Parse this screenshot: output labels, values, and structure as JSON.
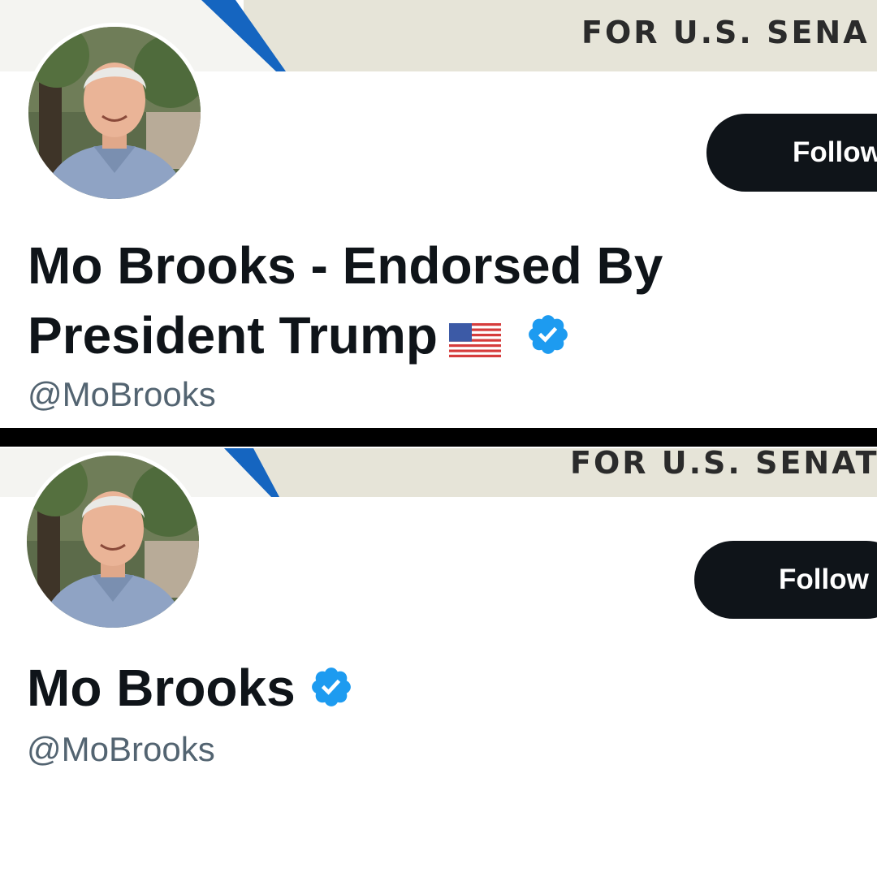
{
  "top_profile": {
    "banner_text": "FOR U.S. SENA",
    "follow_label": "Follow",
    "display_name": "Mo Brooks - Endorsed By President Trump",
    "flag_emoji": "us-flag-icon",
    "handle": "@MoBrooks",
    "verified": true
  },
  "bottom_profile": {
    "banner_text": "FOR U.S. SENAT",
    "follow_label": "Follow",
    "display_name": "Mo Brooks",
    "handle": "@MoBrooks",
    "verified": true
  },
  "colors": {
    "verified_blue": "#1d9bf0",
    "follow_button_bg": "#0f1419",
    "handle_gray": "#536471",
    "banner_blue": "#1565c0",
    "banner_beige": "#e6e4d8",
    "divider": "#000000"
  }
}
